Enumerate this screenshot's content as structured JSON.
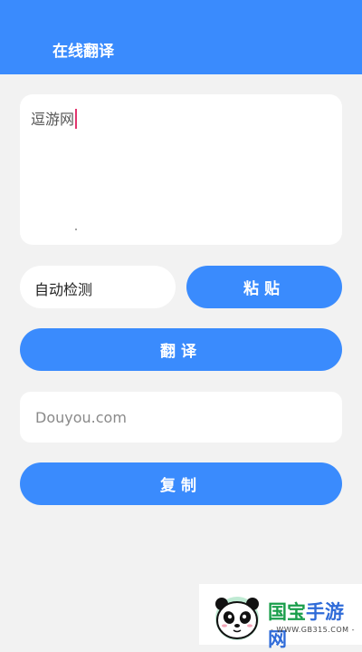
{
  "header": {
    "title": "在线翻译",
    "color": "#3a8bfd"
  },
  "source_input": {
    "value": "逗游网"
  },
  "language_select": {
    "selected": "自动检测"
  },
  "buttons": {
    "paste_label": "粘贴",
    "translate_label": "翻译",
    "copy_label": "复制"
  },
  "result": {
    "value": "Douyou.com"
  },
  "watermark": {
    "brand_part1": "国宝",
    "brand_part2": "手游网",
    "url": "- WWW.GB315.COM -",
    "icon": "panda-logo-icon"
  }
}
